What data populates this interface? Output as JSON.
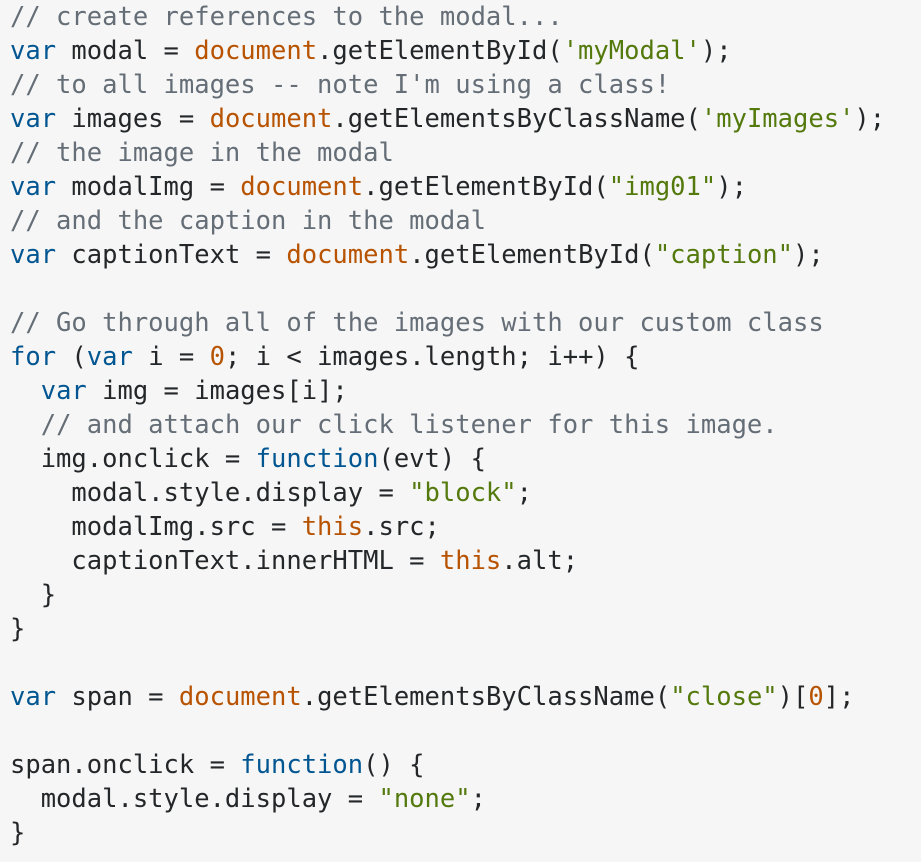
{
  "editor": {
    "theme": {
      "background": "#f6f6f6",
      "plain": "#242729",
      "comment": "#656e77",
      "keyword": "#015692",
      "builtin": "#b75301",
      "string": "#54790d",
      "number": "#b75301"
    },
    "lines": [
      [
        {
          "t": "comment",
          "s": "// create references to the modal..."
        }
      ],
      [
        {
          "t": "keyword",
          "s": "var"
        },
        {
          "t": "plain",
          "s": " modal = "
        },
        {
          "t": "builtin",
          "s": "document"
        },
        {
          "t": "plain",
          "s": ".getElementById("
        },
        {
          "t": "string",
          "s": "'myModal'"
        },
        {
          "t": "plain",
          "s": ");"
        }
      ],
      [
        {
          "t": "comment",
          "s": "// to all images -- note I'm using a class!"
        }
      ],
      [
        {
          "t": "keyword",
          "s": "var"
        },
        {
          "t": "plain",
          "s": " images = "
        },
        {
          "t": "builtin",
          "s": "document"
        },
        {
          "t": "plain",
          "s": ".getElementsByClassName("
        },
        {
          "t": "string",
          "s": "'myImages'"
        },
        {
          "t": "plain",
          "s": ");"
        }
      ],
      [
        {
          "t": "comment",
          "s": "// the image in the modal"
        }
      ],
      [
        {
          "t": "keyword",
          "s": "var"
        },
        {
          "t": "plain",
          "s": " modalImg = "
        },
        {
          "t": "builtin",
          "s": "document"
        },
        {
          "t": "plain",
          "s": ".getElementById("
        },
        {
          "t": "string",
          "s": "\"img01\""
        },
        {
          "t": "plain",
          "s": ");"
        }
      ],
      [
        {
          "t": "comment",
          "s": "// and the caption in the modal"
        }
      ],
      [
        {
          "t": "keyword",
          "s": "var"
        },
        {
          "t": "plain",
          "s": " captionText = "
        },
        {
          "t": "builtin",
          "s": "document"
        },
        {
          "t": "plain",
          "s": ".getElementById("
        },
        {
          "t": "string",
          "s": "\"caption\""
        },
        {
          "t": "plain",
          "s": ");"
        }
      ],
      [],
      [
        {
          "t": "comment",
          "s": "// Go through all of the images with our custom class"
        }
      ],
      [
        {
          "t": "keyword",
          "s": "for"
        },
        {
          "t": "plain",
          "s": " ("
        },
        {
          "t": "keyword",
          "s": "var"
        },
        {
          "t": "plain",
          "s": " i = "
        },
        {
          "t": "number",
          "s": "0"
        },
        {
          "t": "plain",
          "s": "; i < images.length; i++) {"
        }
      ],
      [
        {
          "t": "plain",
          "s": "  "
        },
        {
          "t": "keyword",
          "s": "var"
        },
        {
          "t": "plain",
          "s": " img = images[i];"
        }
      ],
      [
        {
          "t": "plain",
          "s": "  "
        },
        {
          "t": "comment",
          "s": "// and attach our click listener for this image."
        }
      ],
      [
        {
          "t": "plain",
          "s": "  img.onclick = "
        },
        {
          "t": "keyword",
          "s": "function"
        },
        {
          "t": "plain",
          "s": "(evt) {"
        }
      ],
      [
        {
          "t": "plain",
          "s": "    modal.style.display = "
        },
        {
          "t": "string",
          "s": "\"block\""
        },
        {
          "t": "plain",
          "s": ";"
        }
      ],
      [
        {
          "t": "plain",
          "s": "    modalImg.src = "
        },
        {
          "t": "builtin",
          "s": "this"
        },
        {
          "t": "plain",
          "s": ".src;"
        }
      ],
      [
        {
          "t": "plain",
          "s": "    captionText.innerHTML = "
        },
        {
          "t": "builtin",
          "s": "this"
        },
        {
          "t": "plain",
          "s": ".alt;"
        }
      ],
      [
        {
          "t": "plain",
          "s": "  }"
        }
      ],
      [
        {
          "t": "plain",
          "s": "}"
        }
      ],
      [],
      [
        {
          "t": "keyword",
          "s": "var"
        },
        {
          "t": "plain",
          "s": " span = "
        },
        {
          "t": "builtin",
          "s": "document"
        },
        {
          "t": "plain",
          "s": ".getElementsByClassName("
        },
        {
          "t": "string",
          "s": "\"close\""
        },
        {
          "t": "plain",
          "s": ")["
        },
        {
          "t": "number",
          "s": "0"
        },
        {
          "t": "plain",
          "s": "];"
        }
      ],
      [],
      [
        {
          "t": "plain",
          "s": "span.onclick = "
        },
        {
          "t": "keyword",
          "s": "function"
        },
        {
          "t": "plain",
          "s": "() {"
        }
      ],
      [
        {
          "t": "plain",
          "s": "  modal.style.display = "
        },
        {
          "t": "string",
          "s": "\"none\""
        },
        {
          "t": "plain",
          "s": ";"
        }
      ],
      [
        {
          "t": "plain",
          "s": "}"
        }
      ]
    ]
  }
}
